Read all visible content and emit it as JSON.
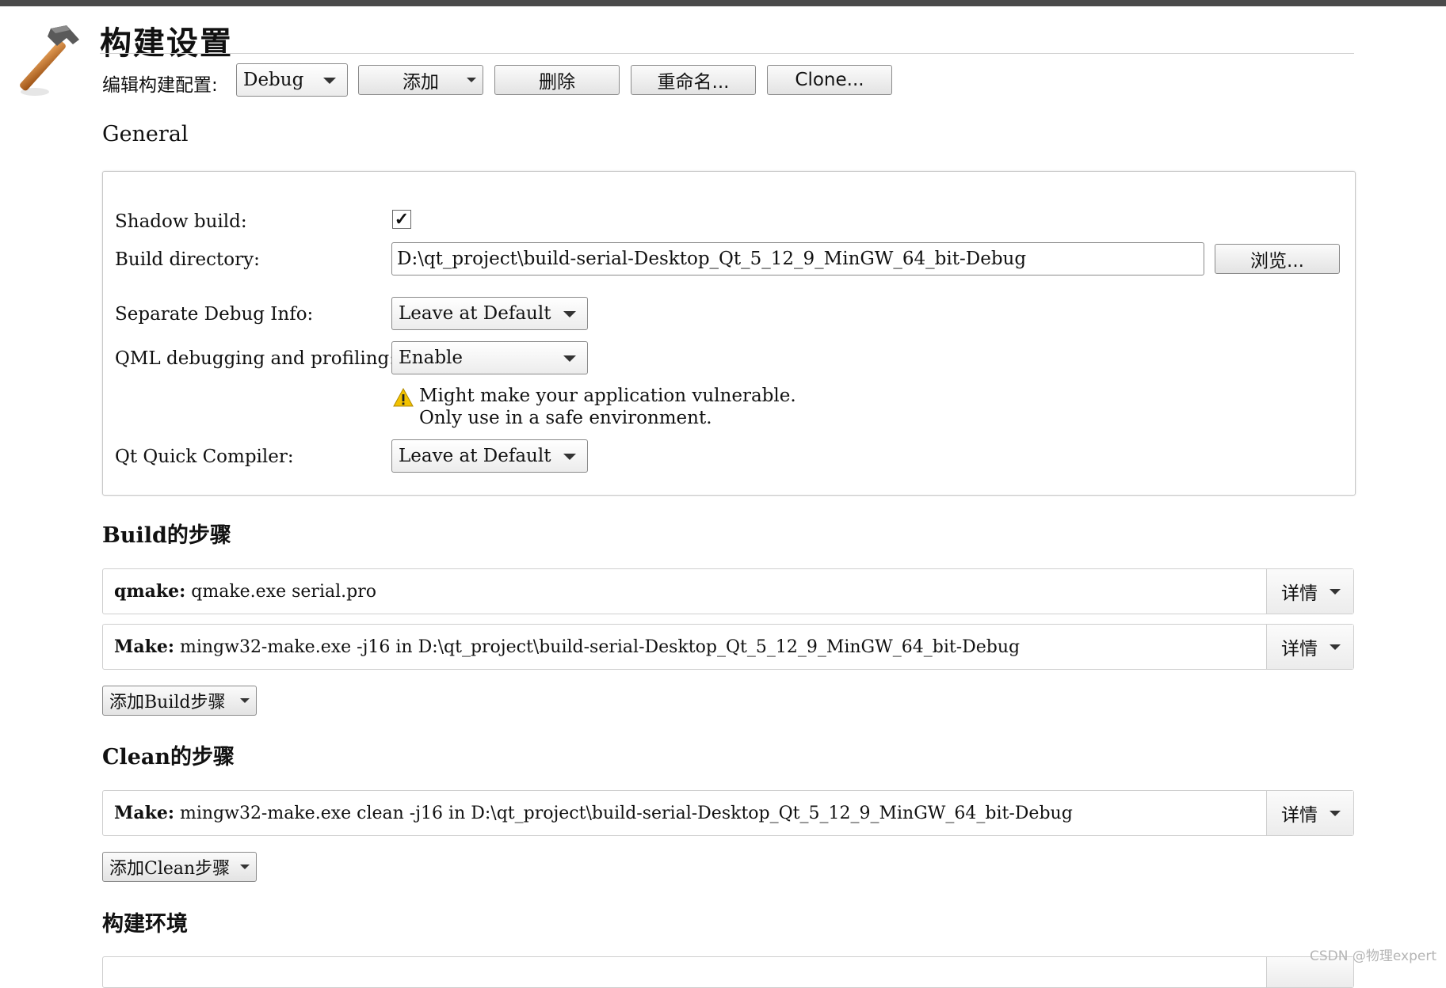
{
  "header": {
    "title": "构建设置",
    "edit_label": "编辑构建配置:",
    "config_select": "Debug",
    "add_button": "添加",
    "delete_button": "删除",
    "rename_button": "重命名...",
    "clone_button": "Clone..."
  },
  "general": {
    "section_title": "General",
    "shadow_build_label": "Shadow build:",
    "shadow_build_checked": "✓",
    "build_dir_label": "Build directory:",
    "build_dir_value": "D:\\qt_project\\build-serial-Desktop_Qt_5_12_9_MinGW_64_bit-Debug",
    "browse_button": "浏览...",
    "separate_debug_label": "Separate Debug Info:",
    "separate_debug_value": "Leave at Default",
    "qml_debug_label": "QML debugging and profiling:",
    "qml_debug_value": "Enable",
    "warning_line1": "Might make your application vulnerable.",
    "warning_line2": "Only use in a safe environment.",
    "quick_compiler_label": "Qt Quick Compiler:",
    "quick_compiler_value": "Leave at Default"
  },
  "build_steps": {
    "section_title": "Build的步骤",
    "steps": [
      {
        "name": "qmake:",
        "command": " qmake.exe serial.pro",
        "details": "详情"
      },
      {
        "name": "Make:",
        "command": " mingw32-make.exe -j16 in D:\\qt_project\\build-serial-Desktop_Qt_5_12_9_MinGW_64_bit-Debug",
        "details": "详情"
      }
    ],
    "add_button": "添加Build步骤"
  },
  "clean_steps": {
    "section_title": "Clean的步骤",
    "steps": [
      {
        "name": "Make:",
        "command": " mingw32-make.exe clean -j16 in D:\\qt_project\\build-serial-Desktop_Qt_5_12_9_MinGW_64_bit-Debug",
        "details": "详情"
      }
    ],
    "add_button": "添加Clean步骤"
  },
  "build_env": {
    "section_title": "构建环境"
  },
  "watermark": "CSDN @物理expert",
  "colors": {
    "topbar": "#4a4a4a",
    "warning": "#f2c200",
    "hammer_handle": "#c8782a"
  }
}
